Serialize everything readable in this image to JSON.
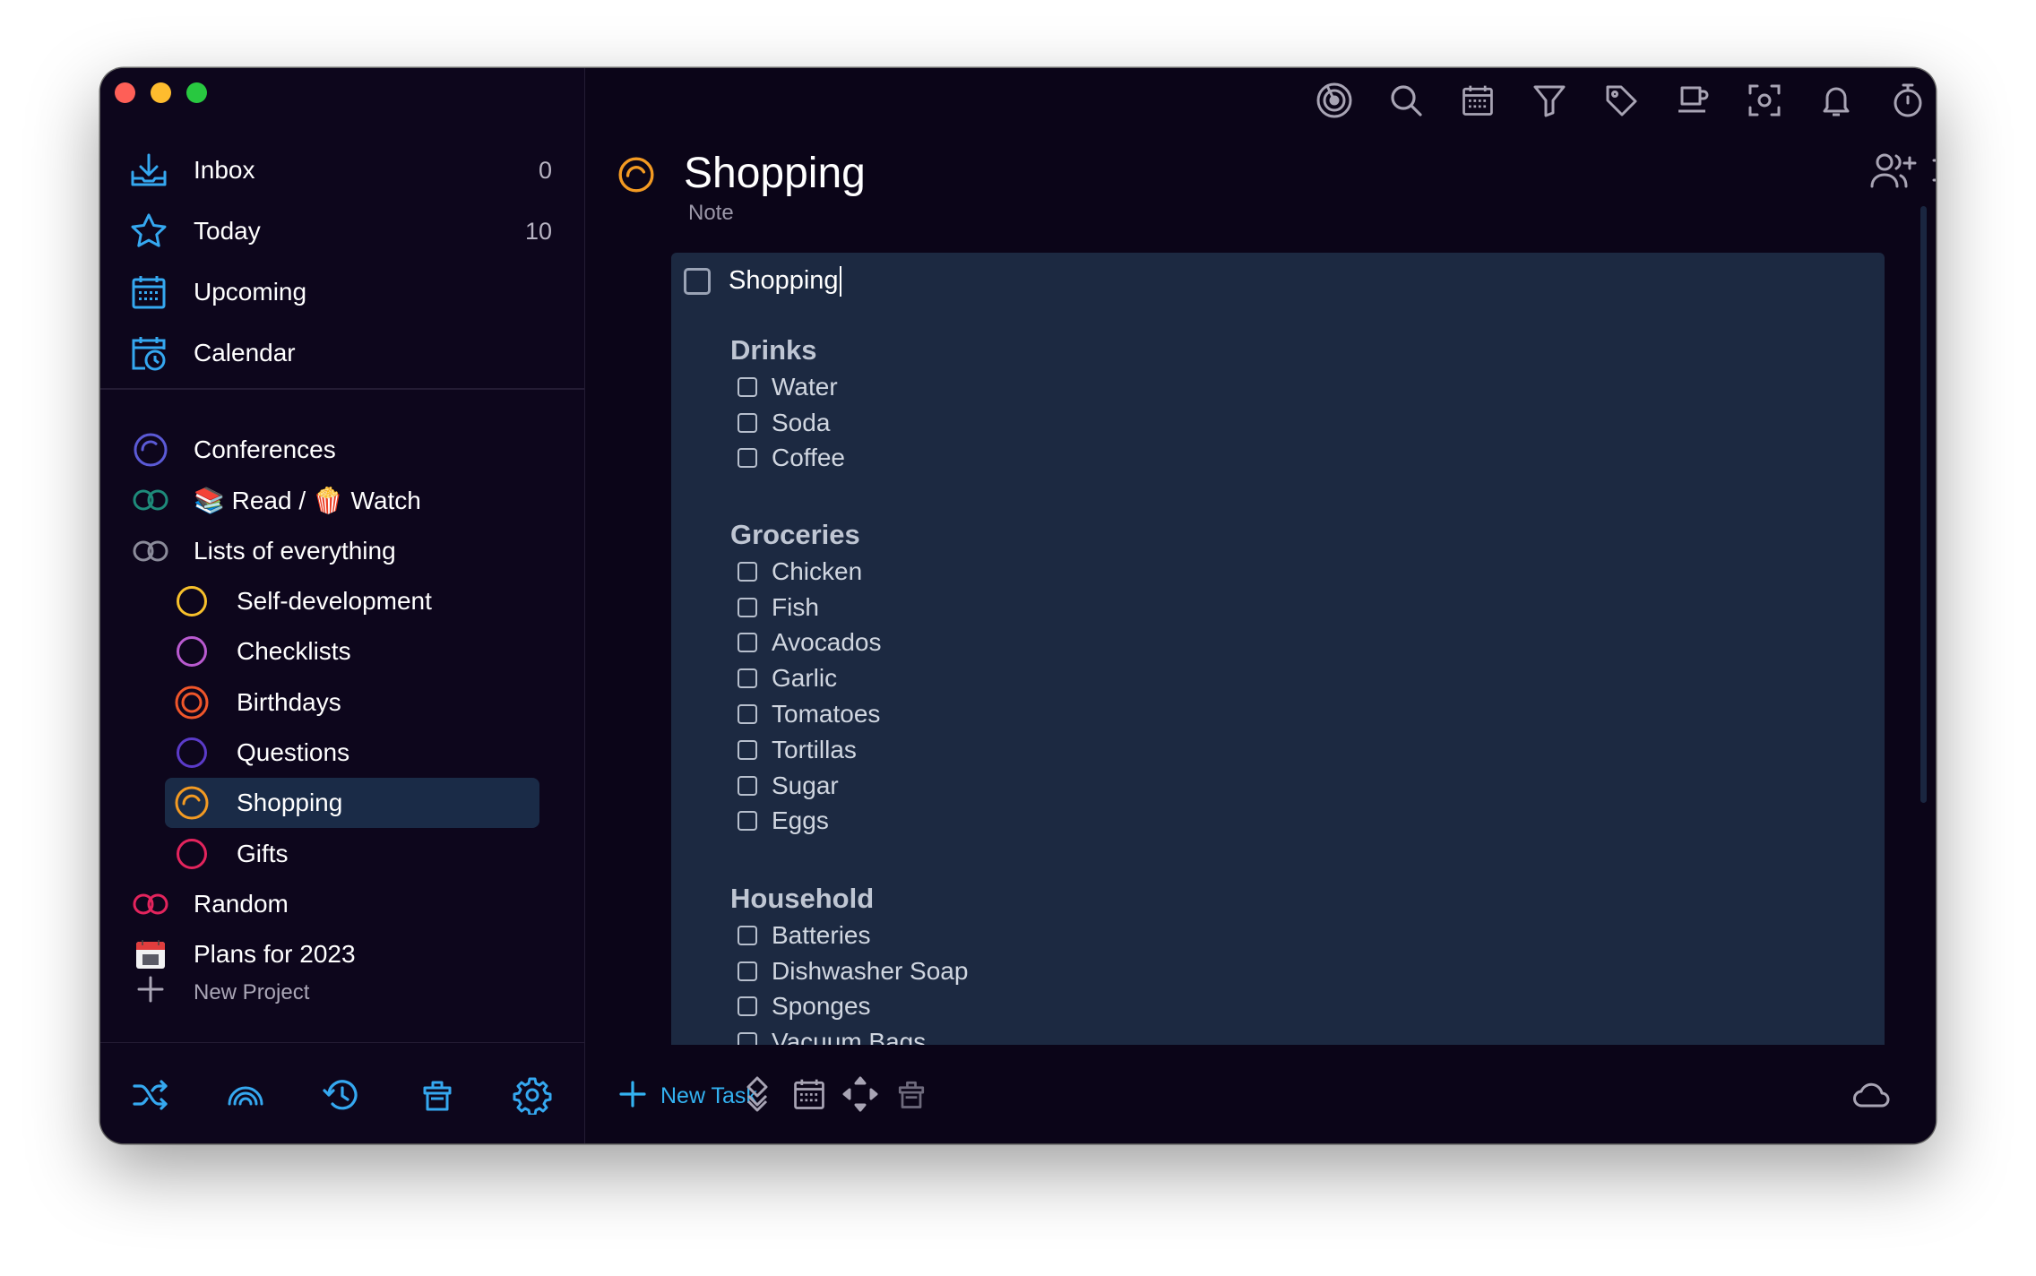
{
  "app": {
    "accent": "#33b3f2",
    "background": "#0b0518"
  },
  "nav": {
    "items": [
      {
        "label": "Inbox",
        "count": "0",
        "icon": "inbox-icon"
      },
      {
        "label": "Today",
        "count": "10",
        "icon": "star-icon"
      },
      {
        "label": "Upcoming",
        "count": "",
        "icon": "calendar-grid-icon"
      },
      {
        "label": "Calendar",
        "count": "",
        "icon": "calendar-clock-icon"
      }
    ]
  },
  "projects": [
    {
      "label": "Conferences",
      "icon": "progress-ring-icon",
      "color": "#5b5ad6"
    },
    {
      "label": "📚 Read / 🍿 Watch",
      "icon": "area-icon",
      "color": "#1e8a7a"
    },
    {
      "label": "Lists of everything",
      "icon": "area-icon",
      "color": "#8b8b9a"
    },
    {
      "label": "Self-development",
      "icon": "ring-icon",
      "color": "#f7c02b"
    },
    {
      "label": "Checklists",
      "icon": "ring-icon",
      "color": "#b95ad0"
    },
    {
      "label": "Birthdays",
      "icon": "ring-icon",
      "color": "#f0562a"
    },
    {
      "label": "Questions",
      "icon": "ring-icon",
      "color": "#5b3bc9"
    },
    {
      "label": "Shopping",
      "icon": "ring-icon",
      "color": "#f39a22"
    },
    {
      "label": "Gifts",
      "icon": "ring-icon",
      "color": "#e3245d"
    },
    {
      "label": "Random",
      "icon": "area-icon",
      "color": "#e3245d"
    },
    {
      "label": "Plans for 2023",
      "icon": "calendar-emoji-icon",
      "color": "#ffffff"
    }
  ],
  "sidebar_footer": {
    "new_project_label": "New Project"
  },
  "main": {
    "title": "Shopping",
    "subtitle": "Note",
    "task": {
      "title": "Shopping"
    },
    "sections": [
      {
        "heading": "Drinks",
        "items": [
          "Water",
          "Soda",
          "Coffee"
        ]
      },
      {
        "heading": "Groceries",
        "items": [
          "Chicken",
          "Fish",
          "Avocados",
          "Garlic",
          "Tomatoes",
          "Tortillas",
          "Sugar",
          "Eggs"
        ]
      },
      {
        "heading": "Household",
        "items": [
          "Batteries",
          "Dishwasher Soap",
          "Sponges",
          "Vacuum Bags"
        ]
      }
    ],
    "new_task_label": "New Task"
  }
}
